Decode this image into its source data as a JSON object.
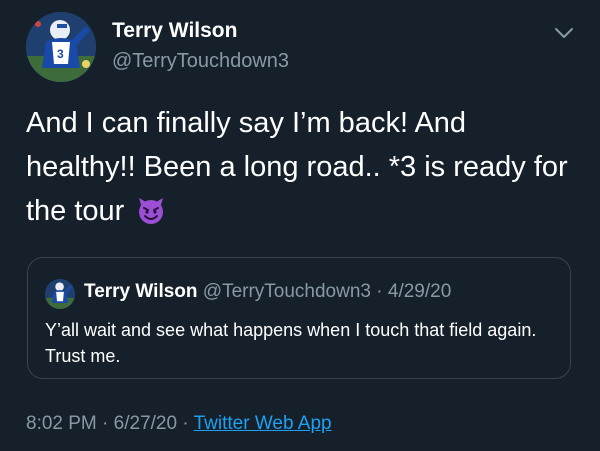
{
  "tweet": {
    "author": {
      "display_name": "Terry Wilson",
      "handle": "@TerryTouchdown3",
      "avatar": "player-avatar-photo"
    },
    "menu_icon": "chevron-down-icon",
    "text_line1": "And I can finally say I’m back! And",
    "text_line2": "healthy!! Been a long road.. *3 is ready for",
    "text_line3": "the tour",
    "emoji": "smiling-devil-emoji",
    "quoted": {
      "display_name": "Terry Wilson",
      "handle": "@TerryTouchdown3",
      "separator": "·",
      "date": "4/29/20",
      "text": "Y’all wait and see what happens when I touch that field again. Trust me."
    },
    "footer": {
      "time": "8:02 PM",
      "sep1": "·",
      "date": "6/27/20",
      "sep2": "·",
      "source": "Twitter Web App"
    }
  },
  "colors": {
    "background": "#15202b",
    "primary_text": "#ffffff",
    "secondary_text": "#8899a6",
    "link": "#1da1f2",
    "border": "#38444d",
    "emoji": "#9b4fd4"
  }
}
